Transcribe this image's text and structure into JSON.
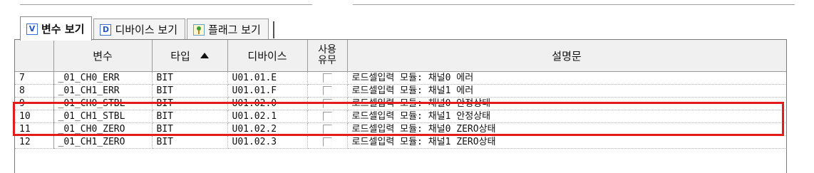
{
  "tabs": [
    {
      "icon_letter": "V",
      "label": "변수 보기",
      "icon": "variable-icon"
    },
    {
      "icon_letter": "D",
      "label": "디바이스 보기",
      "icon": "device-icon"
    },
    {
      "icon_letter": "",
      "label": "플래그 보기",
      "icon": "flag-icon"
    }
  ],
  "columns": {
    "num": "",
    "variable": "변수",
    "type": "타입",
    "device": "디바이스",
    "use_line1": "사용",
    "use_line2": "유무",
    "description": "설명문"
  },
  "sort": {
    "column": "type",
    "direction": "ascending"
  },
  "rows": [
    {
      "num": "7",
      "variable": "_01_CH0_ERR",
      "type": "BIT",
      "device": "U01.01.E",
      "use": false,
      "description": "로드셀입력 모듈: 채널0 에러"
    },
    {
      "num": "8",
      "variable": "_01_CH1_ERR",
      "type": "BIT",
      "device": "U01.01.F",
      "use": false,
      "description": "로드셀입력 모듈: 채널1 에러"
    },
    {
      "num": "9",
      "variable": "_01_CH0_STBL",
      "type": "BIT",
      "device": "U01.02.0",
      "use": false,
      "description": "로드셀입력 모듈: 채널0 안정상태"
    },
    {
      "num": "10",
      "variable": "_01_CH1_STBL",
      "type": "BIT",
      "device": "U01.02.1",
      "use": false,
      "description": "로드셀입력 모듈: 채널1 안정상태"
    },
    {
      "num": "11",
      "variable": "_01_CH0_ZERO",
      "type": "BIT",
      "device": "U01.02.2",
      "use": false,
      "description": "로드셀입력 모듈: 채널0 ZERO상태"
    },
    {
      "num": "12",
      "variable": "_01_CH1_ZERO",
      "type": "BIT",
      "device": "U01.02.3",
      "use": false,
      "description": "로드셀입력 모듈: 채널1 ZERO상태"
    }
  ],
  "highlighted_rows": [
    "9",
    "10"
  ],
  "colors": {
    "highlight": "#e31b1b",
    "header_bg": "#f0f0f0",
    "tab_icon": "#2456c9"
  }
}
